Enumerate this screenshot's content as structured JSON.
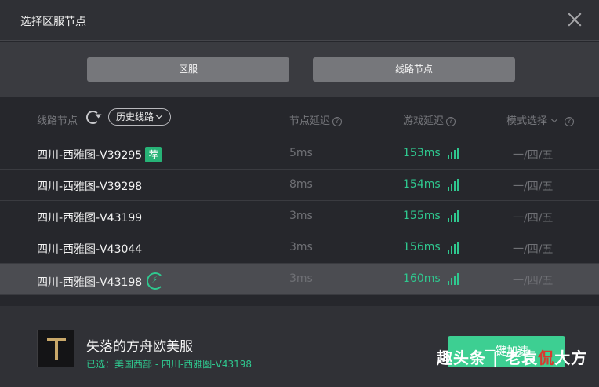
{
  "window": {
    "title": "选择区服节点"
  },
  "tabs": [
    {
      "label": "区服"
    },
    {
      "label": "线路节点"
    }
  ],
  "table": {
    "headers": {
      "node": "线路节点",
      "history_button": "历史线路",
      "node_latency": "节点延迟",
      "game_latency": "游戏延迟",
      "mode": "模式选择"
    },
    "rows": [
      {
        "name": "四川-西雅图-V39295",
        "node_latency": "5ms",
        "game_latency": "153ms",
        "mode": "一/四/五",
        "badge": "荐"
      },
      {
        "name": "四川-西雅图-V39298",
        "node_latency": "8ms",
        "game_latency": "154ms",
        "mode": "一/四/五"
      },
      {
        "name": "四川-西雅图-V43199",
        "node_latency": "3ms",
        "game_latency": "155ms",
        "mode": "一/四/五"
      },
      {
        "name": "四川-西雅图-V43044",
        "node_latency": "3ms",
        "game_latency": "156ms",
        "mode": "一/四/五"
      },
      {
        "name": "四川-西雅图-V43198",
        "node_latency": "3ms",
        "game_latency": "160ms",
        "mode": "一/四/五",
        "selected": true
      }
    ]
  },
  "footer": {
    "game_name": "失落的方舟欧美服",
    "selected_text": "已选：美国西部 - 四川-西雅图-V43198",
    "accelerate_button": "一键加速"
  },
  "watermark": {
    "part1": "趣头条 | 老袁",
    "part2": "侃",
    "part3": "大方"
  },
  "colors": {
    "accent_green": "#2fc88f",
    "recommend_badge": "#27b377",
    "watermark_red": "#d9382f"
  }
}
